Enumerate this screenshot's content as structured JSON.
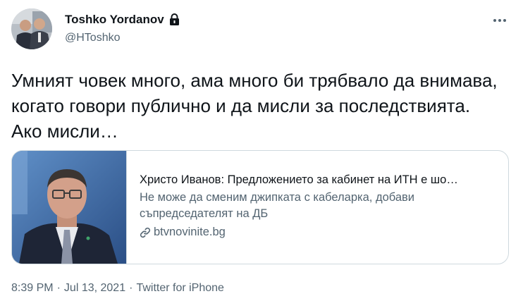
{
  "author": {
    "display_name": "Toshko Yordanov",
    "handle": "@HToshko",
    "protected": true,
    "avatar_icon": "profile-photo-two-men"
  },
  "tweet": {
    "text": "Умният човек много, ама много би трябвало да внимава, когато говори публично и да мисли за последствията. Ако мисли…"
  },
  "card": {
    "title": "Христо Иванов: Предложението за кабинет на ИТН е шо…",
    "description": "Не може да сменим джипката с кабеларка, добави съпредседателят на ДБ",
    "domain": "btvnovinite.bg",
    "thumbnail_icon": "man-in-suit-portrait"
  },
  "meta": {
    "time": "8:39 PM",
    "date": "Jul 13, 2021",
    "separator": "·",
    "source": "Twitter for iPhone"
  },
  "colors": {
    "text_primary": "#0f1419",
    "text_secondary": "#536471",
    "border": "#cfd9de"
  }
}
